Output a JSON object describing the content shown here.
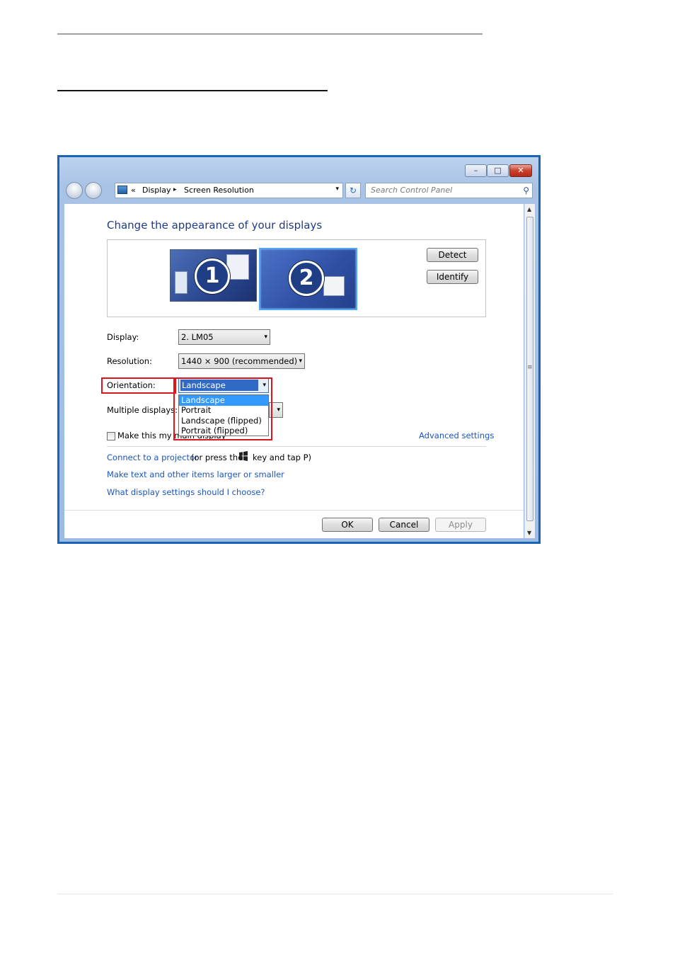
{
  "window": {
    "controls": {
      "minimize": "–",
      "maximize": "□",
      "close": "✕"
    },
    "address": {
      "sep": "«",
      "crumb1": "Display",
      "arrow": "▸",
      "crumb2": "Screen Resolution",
      "drop": "▾"
    },
    "refresh": "↻",
    "search_placeholder": "Search Control Panel",
    "search_icon": "⚲"
  },
  "content": {
    "title": "Change the appearance of your displays",
    "monitors": [
      {
        "number": "1"
      },
      {
        "number": "2"
      }
    ],
    "detect_label": "Detect",
    "identify_label": "Identify",
    "display_label": "Display:",
    "display_value": "2. LM05",
    "resolution_label": "Resolution:",
    "resolution_value": "1440 × 900 (recommended)",
    "orientation_label": "Orientation:",
    "orientation_value": "Landscape",
    "orientation_options": [
      "Landscape",
      "Portrait",
      "Landscape (flipped)",
      "Portrait (flipped)"
    ],
    "multiple_label": "Multiple displays:",
    "main_display_label": "Make this my main display",
    "advanced_link": "Advanced settings",
    "projector_link": "Connect to a projector",
    "projector_text_a": "(or press the",
    "projector_text_b": "key and tap P)",
    "text_size_link": "Make text and other items larger or smaller",
    "help_link": "What display settings should I choose?",
    "ok_label": "OK",
    "cancel_label": "Cancel",
    "apply_label": "Apply"
  },
  "icons": {
    "windows_key": "windows-logo-icon",
    "arrow": "▾"
  }
}
